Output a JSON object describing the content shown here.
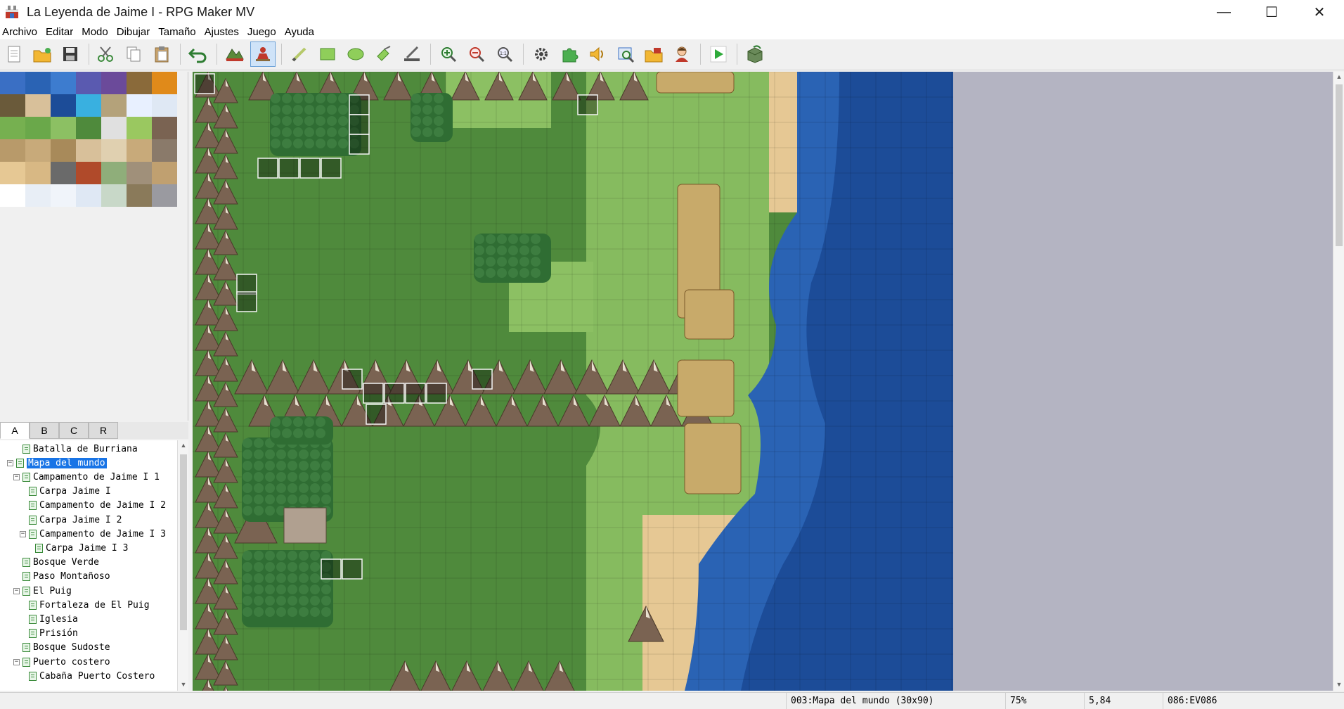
{
  "window": {
    "title": "La Leyenda de Jaime I - RPG Maker MV",
    "minimize": "—",
    "maximize": "☐",
    "close": "✕"
  },
  "menu": [
    "Archivo",
    "Editar",
    "Modo",
    "Dibujar",
    "Tamaño",
    "Ajustes",
    "Juego",
    "Ayuda"
  ],
  "toolbar": {
    "buttons": [
      "new-project-icon",
      "open-project-icon",
      "save-project-icon",
      "cut-icon",
      "copy-icon",
      "paste-icon",
      "undo-icon",
      "map-mode-icon",
      "event-mode-icon",
      "pencil-icon",
      "rectangle-icon",
      "ellipse-icon",
      "fill-icon",
      "shadow-pen-icon",
      "zoom-in-icon",
      "zoom-out-icon",
      "zoom-actual-icon",
      "database-icon",
      "plugin-manager-icon",
      "sound-test-icon",
      "event-searcher-icon",
      "resource-manager-icon",
      "character-generator-icon",
      "playtest-icon",
      "deployment-icon"
    ],
    "active": "event-mode-icon"
  },
  "tileset_tabs": [
    "A",
    "B",
    "C",
    "R"
  ],
  "active_tab": "A",
  "map_tree": [
    {
      "label": "Batalla de Burriana",
      "depth": 1,
      "toggle": ""
    },
    {
      "label": "Mapa del mundo",
      "depth": 0,
      "toggle": "−",
      "selected": true
    },
    {
      "label": "Campamento de Jaime I 1",
      "depth": 1,
      "toggle": "−"
    },
    {
      "label": "Carpa Jaime I",
      "depth": 2,
      "toggle": ""
    },
    {
      "label": "Campamento de Jaime I 2",
      "depth": 2,
      "toggle": ""
    },
    {
      "label": "Carpa Jaime I 2",
      "depth": 2,
      "toggle": ""
    },
    {
      "label": "Campamento de Jaime I 3",
      "depth": 2,
      "toggle": "−"
    },
    {
      "label": "Carpa Jaime I 3",
      "depth": 3,
      "toggle": ""
    },
    {
      "label": "Bosque Verde",
      "depth": 1,
      "toggle": ""
    },
    {
      "label": "Paso Montañoso",
      "depth": 1,
      "toggle": ""
    },
    {
      "label": "El Puig",
      "depth": 1,
      "toggle": "−"
    },
    {
      "label": "Fortaleza de El Puig",
      "depth": 2,
      "toggle": ""
    },
    {
      "label": "Iglesia",
      "depth": 2,
      "toggle": ""
    },
    {
      "label": "Prisión",
      "depth": 2,
      "toggle": ""
    },
    {
      "label": "Bosque Sudoste",
      "depth": 1,
      "toggle": ""
    },
    {
      "label": "Puerto costero",
      "depth": 1,
      "toggle": "−"
    },
    {
      "label": "Cabaña Puerto Costero",
      "depth": 2,
      "toggle": ""
    }
  ],
  "status": {
    "map": "003:Mapa del mundo (30x90)",
    "zoom": "75%",
    "coords": "5,84",
    "event": "086:EV086"
  },
  "colors": {
    "grass_dark": "#4f8a3c",
    "grass_light": "#8cc063",
    "sand": "#e6c894",
    "sea_shallow": "#2a63b4",
    "sea_deep": "#1c4c98",
    "mountain": "#7a6352",
    "forest": "#2f6d33",
    "selection": "#1874e6"
  }
}
